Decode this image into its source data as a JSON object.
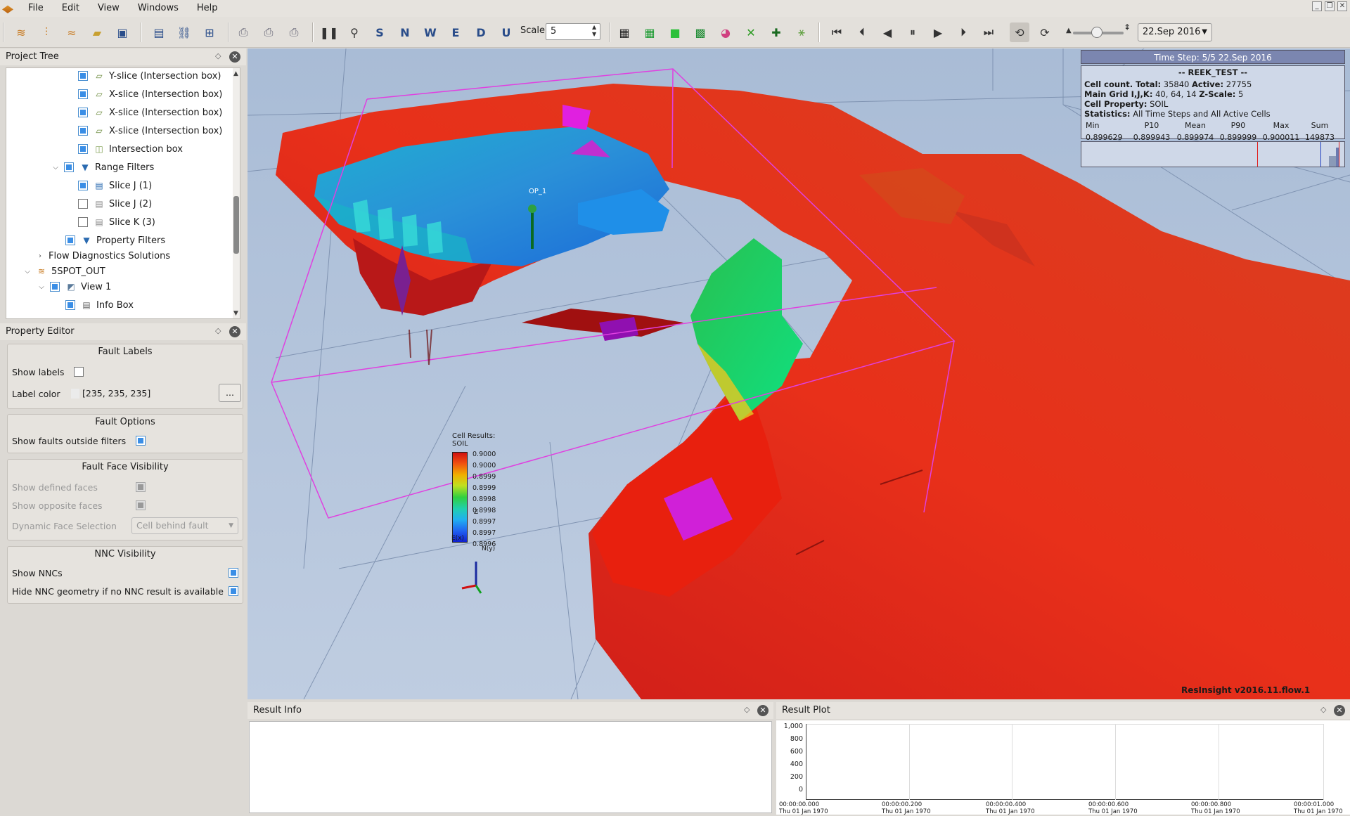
{
  "menu": [
    "File",
    "Edit",
    "View",
    "Windows",
    "Help"
  ],
  "toolbar": {
    "scale_label": "Scale",
    "scale_value": "5",
    "date_value": "22.Sep 2016"
  },
  "project_tree": {
    "title": "Project Tree",
    "rows": [
      {
        "label": "Y-slice (Intersection box)",
        "checked": true,
        "icon": "slice-icon"
      },
      {
        "label": "X-slice (Intersection box)",
        "checked": true,
        "icon": "slice-icon"
      },
      {
        "label": "X-slice (Intersection box)",
        "checked": true,
        "icon": "slice-icon"
      },
      {
        "label": "X-slice (Intersection box)",
        "checked": true,
        "icon": "slice-icon"
      },
      {
        "label": "Intersection box",
        "checked": true,
        "icon": "box-icon"
      },
      {
        "label": "Range Filters",
        "checked": true,
        "icon": "filter-icon"
      },
      {
        "label": "Slice J (1)",
        "checked": true,
        "icon": "slice-filter-icon"
      },
      {
        "label": "Slice J (2)",
        "checked": false,
        "icon": "slice-filter-icon"
      },
      {
        "label": "Slice K (3)",
        "checked": false,
        "icon": "slice-filter-icon"
      },
      {
        "label": "Property Filters",
        "checked": true,
        "icon": "filter-icon"
      },
      {
        "label": "Flow Diagnostics Solutions",
        "checked": null,
        "icon": ""
      },
      {
        "label": "5SPOT_OUT",
        "checked": null,
        "icon": "case-icon"
      },
      {
        "label": "View 1",
        "checked": true,
        "icon": "view-icon"
      },
      {
        "label": "Info Box",
        "checked": true,
        "icon": "infobox-icon"
      }
    ]
  },
  "property_editor": {
    "title": "Property Editor",
    "fault_labels": {
      "title": "Fault Labels",
      "show_labels": "Show labels",
      "label_color": "Label color",
      "label_color_value": "[235, 235, 235]",
      "more_button": "..."
    },
    "fault_options": {
      "title": "Fault Options",
      "show_faults_outside": "Show faults outside filters"
    },
    "fault_face": {
      "title": "Fault Face Visibility",
      "show_defined": "Show defined faces",
      "show_opposite": "Show opposite faces",
      "dynamic": "Dynamic Face Selection",
      "dynamic_value": "Cell behind fault"
    },
    "nnc": {
      "title": "NNC Visibility",
      "show_nncs": "Show NNCs",
      "hide_nnc": "Hide NNC geometry if no NNC result is available"
    }
  },
  "viewport": {
    "well_label": "OP_1",
    "legend": {
      "title1": "Cell Results:",
      "title2": "SOIL",
      "ticks": [
        "0.9000",
        "0.9000",
        "0.8999",
        "0.8999",
        "0.8998",
        "0.8998",
        "0.8997",
        "0.8997",
        "0.8996"
      ]
    },
    "axes": {
      "z": "Z",
      "e": "E(x)",
      "n": "N(y)"
    },
    "version": "ResInsight v2016.11.flow.1",
    "info": {
      "timestep": "Time Step: 5/5 22.Sep 2016",
      "case": "-- REEK_TEST --",
      "line1_a": "Cell count. Total:",
      "line1_b": "35840",
      "line1_c": "Active:",
      "line1_d": "27755",
      "line2_a": "Main Grid I,J,K:",
      "line2_b": "40, 64, 14",
      "line2_c": "Z-Scale:",
      "line2_d": "5",
      "line3_a": "Cell Property:",
      "line3_b": "SOIL",
      "line4_a": "Statistics:",
      "line4_b": "All Time Steps and All Active Cells",
      "stat_headers": [
        "Min",
        "P10",
        "Mean",
        "P90",
        "Max",
        "Sum"
      ],
      "stat_values": [
        "0.899629",
        "0.899943",
        "0.899974",
        "0.899999",
        "0.900011",
        "149873"
      ]
    }
  },
  "result_info": {
    "title": "Result Info"
  },
  "result_plot": {
    "title": "Result Plot",
    "yticks": [
      "1,000",
      "800",
      "600",
      "400",
      "200",
      "0"
    ],
    "xticks": [
      {
        "t": "00:00:00.000",
        "d": "Thu 01 Jan 1970"
      },
      {
        "t": "00:00:00.200",
        "d": "Thu 01 Jan 1970"
      },
      {
        "t": "00:00:00.400",
        "d": "Thu 01 Jan 1970"
      },
      {
        "t": "00:00:00.600",
        "d": "Thu 01 Jan 1970"
      },
      {
        "t": "00:00:00.800",
        "d": "Thu 01 Jan 1970"
      },
      {
        "t": "00:00:01.000",
        "d": "Thu 01 Jan 1970"
      }
    ]
  }
}
